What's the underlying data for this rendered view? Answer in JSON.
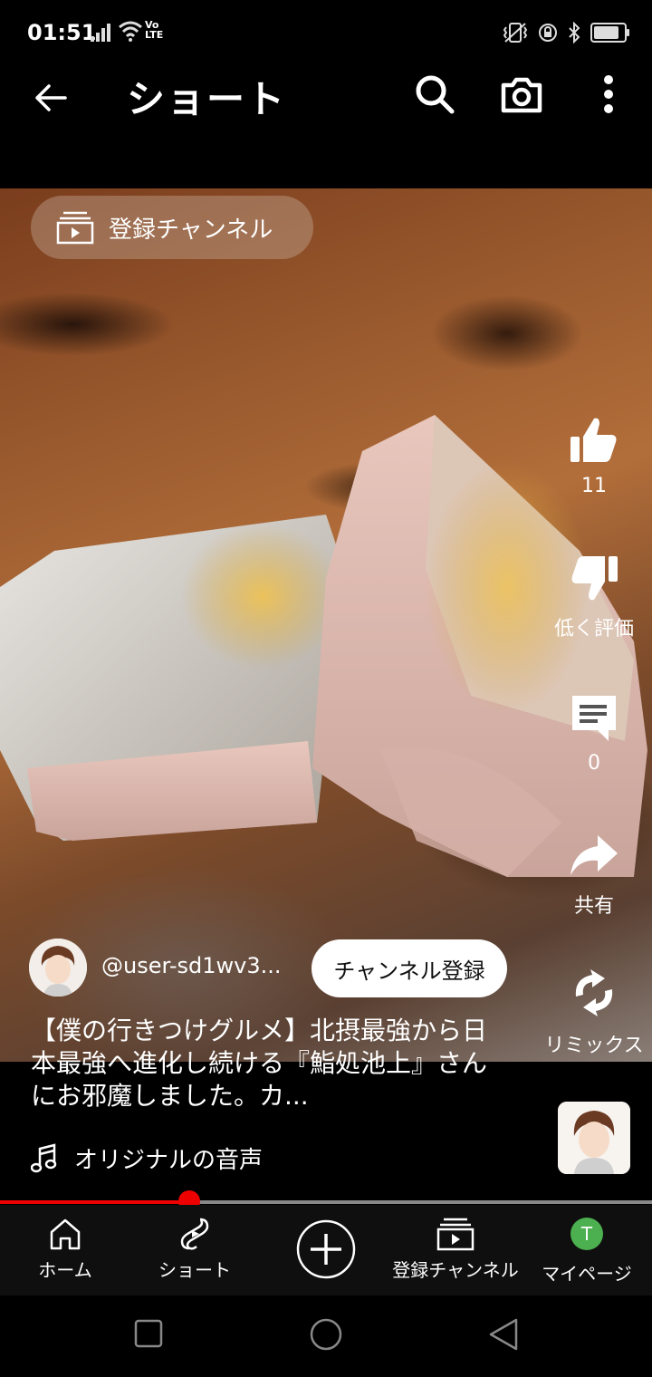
{
  "status_bar": {
    "time": "01:51",
    "network": "Vo LTE",
    "battery_level": 0.85,
    "icons": [
      "signal-icon",
      "wifi-icon",
      "vibrate-icon",
      "lock-rotation-icon",
      "bluetooth-icon",
      "battery-icon"
    ]
  },
  "header": {
    "title": "ショート",
    "icons": [
      "back-arrow-icon",
      "search-icon",
      "camera-icon",
      "more-vert-icon"
    ]
  },
  "video": {
    "subscriptions_chip": "登録チャンネル",
    "actions": {
      "like_count": "11",
      "dislike_label": "低く評価",
      "comment_count": "0",
      "share_label": "共有",
      "remix_label": "リミックス"
    },
    "channel": {
      "handle": "@user-sd1wv3...",
      "subscribe_label": "チャンネル登録"
    },
    "description": "【僕の行きつけグルメ】北摂最強から日本最強へ進化し続ける『鮨処池上』さんにお邪魔しました。カ...",
    "sound_label": "オリジナルの音声",
    "progress": 0.29
  },
  "bottom_nav": {
    "items": [
      {
        "label": "ホーム",
        "icon": "home-icon"
      },
      {
        "label": "ショート",
        "icon": "shorts-icon"
      },
      {
        "label": "",
        "icon": "create-plus-icon"
      },
      {
        "label": "登録チャンネル",
        "icon": "subscriptions-icon"
      },
      {
        "label": "マイページ",
        "icon": "avatar-icon",
        "avatar_letter": "T"
      }
    ]
  },
  "system_nav": [
    "recents-square-icon",
    "home-circle-icon",
    "back-triangle-icon"
  ],
  "colors": {
    "progress_red": "#e00000",
    "avatar_green": "#4caf50",
    "nav_background": "#0f0f0f"
  }
}
